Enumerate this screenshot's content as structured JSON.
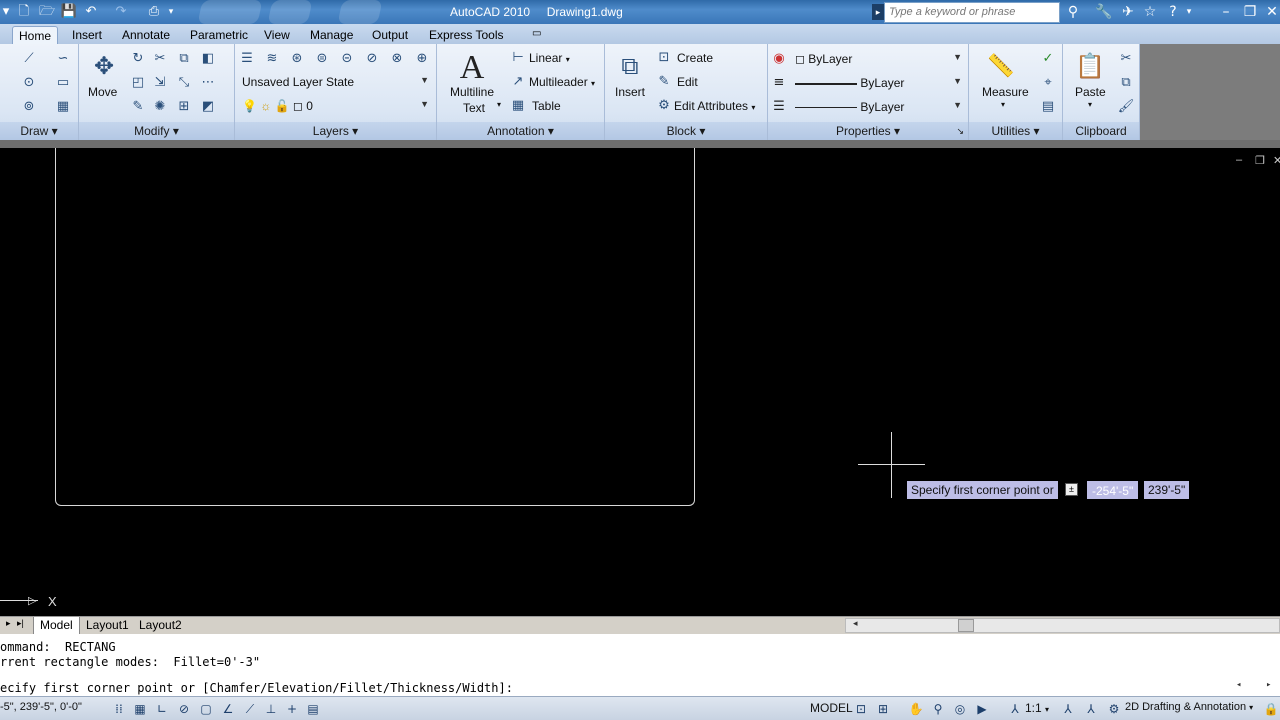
{
  "title": {
    "app": "AutoCAD 2010",
    "file": "Drawing1.dwg"
  },
  "search": {
    "placeholder": "Type a keyword or phrase"
  },
  "tabs": [
    "Home",
    "Insert",
    "Annotate",
    "Parametric",
    "View",
    "Manage",
    "Output",
    "Express Tools"
  ],
  "panels": {
    "draw": "Draw",
    "modify": {
      "label": "Modify",
      "move": "Move"
    },
    "layers": {
      "label": "Layers",
      "layer_state": "Unsaved Layer State",
      "current_layer": "0"
    },
    "annotation": {
      "label": "Annotation",
      "multiline_text_1": "Multiline",
      "multiline_text_2": "Text",
      "linear": "Linear",
      "multileader": "Multileader",
      "table": "Table"
    },
    "block": {
      "label": "Block",
      "insert": "Insert",
      "create": "Create",
      "edit": "Edit",
      "edit_attributes": "Edit Attributes"
    },
    "properties": {
      "label": "Properties",
      "color": "ByLayer",
      "lineweight": "ByLayer",
      "linetype": "ByLayer"
    },
    "utilities": {
      "label": "Utilities",
      "measure": "Measure"
    },
    "clipboard": {
      "label": "Clipboard",
      "paste": "Paste"
    }
  },
  "canvas": {
    "tooltip": "Specify first corner point or",
    "coord_x": "-254'-5\"",
    "coord_y": "239'-5\"",
    "axis_x": "X"
  },
  "layout_tabs": [
    "Model",
    "Layout1",
    "Layout2"
  ],
  "command_lines": [
    "ommand:  RECTANG",
    "rrent rectangle modes:  Fillet=0'-3\"",
    "",
    "ecify first corner point or [Chamfer/Elevation/Fillet/Thickness/Width]:"
  ],
  "status": {
    "coords": "-5\", 239'-5\", 0'-0\"",
    "model": "MODEL",
    "scale": "1:1",
    "workspace": "2D Drafting & Annotation"
  },
  "colors": {
    "title_bar": "#3a76b8",
    "canvas": "#000000",
    "tooltip": "#bdbde6",
    "dyn_input": "#4a7bd0"
  }
}
